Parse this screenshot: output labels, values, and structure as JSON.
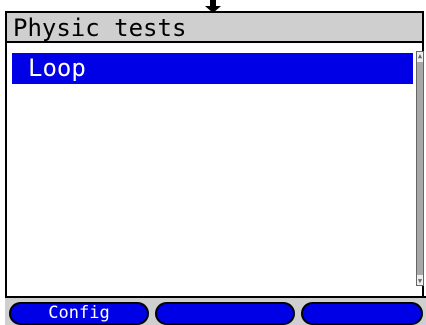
{
  "title": "Physic tests",
  "menu": {
    "items": [
      {
        "label": "Loop",
        "selected": true
      }
    ]
  },
  "softkeys": [
    {
      "label": "Config"
    },
    {
      "label": ""
    },
    {
      "label": ""
    }
  ],
  "colors": {
    "selection": "#0000e6",
    "title_bar": "#cfcfcf",
    "softkey": "#0000e6"
  },
  "icons": {
    "top_indicator": "down-arrow-icon",
    "scroll_up": "scroll-up-arrow-icon",
    "scroll_down": "scroll-down-arrow-icon"
  }
}
